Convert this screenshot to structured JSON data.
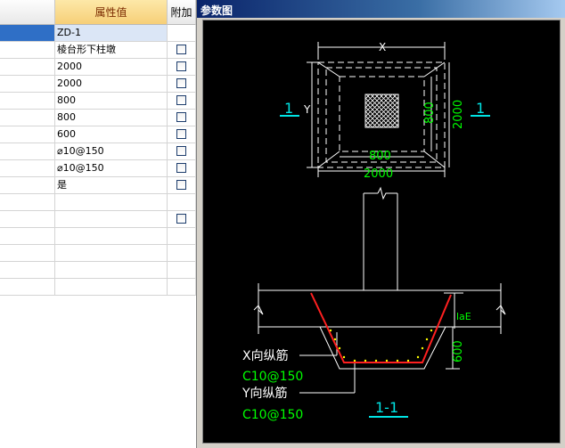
{
  "grid": {
    "headers": {
      "name": "",
      "value": "属性值",
      "add": "附加"
    },
    "rows": [
      {
        "value": "ZD-1",
        "checkbox": false,
        "selected": true
      },
      {
        "value": "棱台形下柱墩",
        "checkbox": true
      },
      {
        "value": "2000",
        "checkbox": true
      },
      {
        "value": "2000",
        "checkbox": true
      },
      {
        "value": "800",
        "checkbox": true
      },
      {
        "value": "800",
        "checkbox": true
      },
      {
        "value": "600",
        "checkbox": true
      },
      {
        "value": "⌀10@150",
        "checkbox": true
      },
      {
        "value": "⌀10@150",
        "checkbox": true
      },
      {
        "value": "是",
        "checkbox": true
      },
      {
        "value": "",
        "checkbox": false
      },
      {
        "value": "",
        "checkbox": true
      },
      {
        "value": "",
        "checkbox": false
      },
      {
        "value": "",
        "checkbox": false
      },
      {
        "value": "",
        "checkbox": false
      },
      {
        "value": "",
        "checkbox": false
      }
    ]
  },
  "window": {
    "title": "参数图"
  },
  "drawing": {
    "plan": {
      "dim_x": "X",
      "dim_y": "Y",
      "dim_inner_w": "800",
      "dim_inner_h": "800",
      "dim_outer_w": "2000",
      "dim_outer_h": "2000",
      "section_mark_left": "1",
      "section_mark_right": "1"
    },
    "section": {
      "lae_label": "laE",
      "depth_label": "600",
      "x_rebar_label": "X向纵筋",
      "x_rebar_spec": "C10@150",
      "y_rebar_label": "Y向纵筋",
      "y_rebar_spec": "C10@150",
      "section_title": "1-1"
    }
  },
  "colors": {
    "canvas_bg": "#000000",
    "line": "#ffffff",
    "dim_text": "#00ff00",
    "mark": "#00e5e5",
    "rebar": "#ff2020",
    "dots": "#ffff00"
  }
}
